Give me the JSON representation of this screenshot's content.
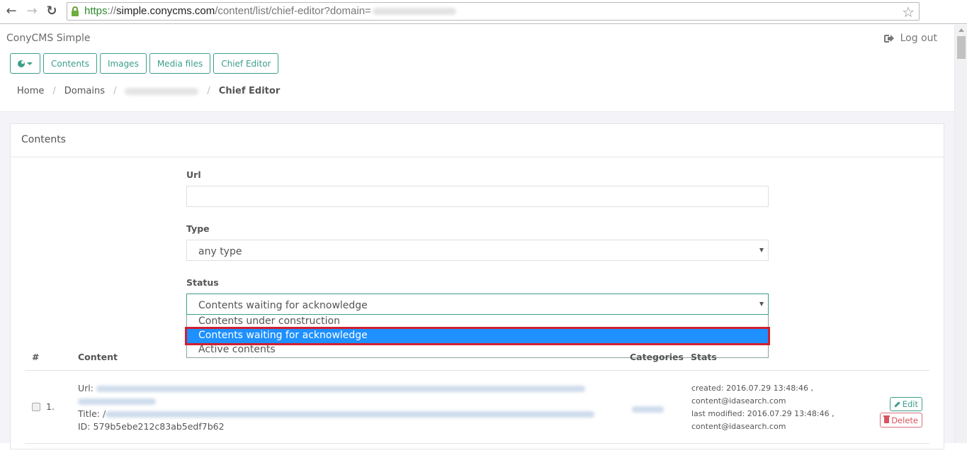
{
  "browser": {
    "url_scheme": "https",
    "url_separator": "://",
    "url_host": "simple.conycms.com",
    "url_path": "/content/list/chief-editor?domain="
  },
  "app": {
    "brand": "ConyCMS Simple",
    "logout_label": "Log out"
  },
  "toolbar": {
    "buttons": [
      {
        "label": "Contents"
      },
      {
        "label": "Images"
      },
      {
        "label": "Media files"
      },
      {
        "label": "Chief Editor"
      }
    ]
  },
  "breadcrumb": {
    "items": [
      "Home",
      "Domains"
    ],
    "separator": "/",
    "active": "Chief Editor"
  },
  "panel": {
    "title": "Contents"
  },
  "form": {
    "url_label": "Url",
    "url_value": "",
    "type_label": "Type",
    "type_value": "any type",
    "status_label": "Status",
    "status_value": "Contents waiting for acknowledge",
    "status_options": [
      {
        "label": "Contents under construction",
        "selected": false
      },
      {
        "label": "Contents waiting for acknowledge",
        "selected": true
      },
      {
        "label": "Active contents",
        "selected": false
      }
    ]
  },
  "table": {
    "headers": {
      "num": "#",
      "content": "Content",
      "categories": "Categories",
      "stats": "Stats"
    },
    "rows": [
      {
        "num": "1.",
        "url_label": "Url:",
        "title_label": "Title: /",
        "id_line": "ID: 579b5ebe212c83ab5edf7b62",
        "stats_created": "created: 2016.07.29 13:48:46 ,",
        "stats_created_by": "content@idasearch.com",
        "stats_modified": "last modified: 2016.07.29 13:48:46 ,",
        "stats_modified_by": "content@idasearch.com",
        "edit_label": "Edit",
        "delete_label": "Delete"
      }
    ]
  }
}
